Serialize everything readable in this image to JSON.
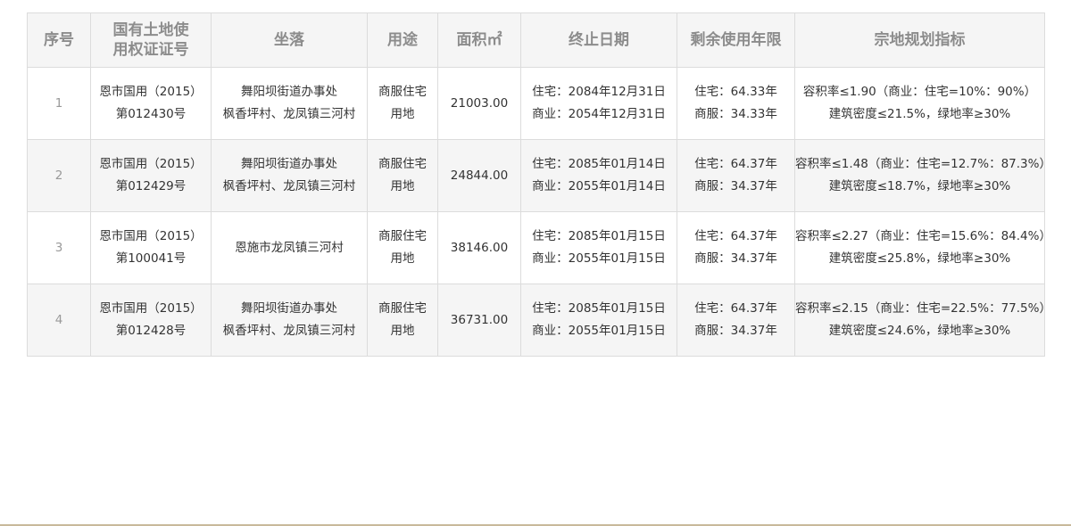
{
  "table": {
    "headers": [
      "序号",
      "国有土地使用权证证号",
      "坐落",
      "用途",
      "面积㎡",
      "终止日期",
      "剩余使用年限",
      "宗地规划指标"
    ],
    "header_lines": {
      "cert_line1": "国有土地使",
      "cert_line2": "用权证证号"
    },
    "rows": [
      {
        "idx": "1",
        "cert_l1": "恩市国用（2015）",
        "cert_l2": "第012430号",
        "loc_l1": "舞阳坝街道办事处",
        "loc_l2": "枫香坪村、龙凤镇三河村",
        "use_l1": "商服住宅",
        "use_l2": "用地",
        "area": "21003.00",
        "end_l1": "住宅：2084年12月31日",
        "end_l2": "商业：2054年12月31日",
        "rem_l1": "住宅：64.33年",
        "rem_l2": "商服：34.33年",
        "spec_l1": "容积率≤1.90（商业：住宅=10%：90%）",
        "spec_l2": "建筑密度≤21.5%，绿地率≥30%"
      },
      {
        "idx": "2",
        "cert_l1": "恩市国用（2015）",
        "cert_l2": "第012429号",
        "loc_l1": "舞阳坝街道办事处",
        "loc_l2": "枫香坪村、龙凤镇三河村",
        "use_l1": "商服住宅",
        "use_l2": "用地",
        "area": "24844.00",
        "end_l1": "住宅：2085年01月14日",
        "end_l2": "商业：2055年01月14日",
        "rem_l1": "住宅：64.37年",
        "rem_l2": "商服：34.37年",
        "spec_l1": "容积率≤1.48（商业：住宅=12.7%：87.3%）",
        "spec_l2": "建筑密度≤18.7%，绿地率≥30%"
      },
      {
        "idx": "3",
        "cert_l1": "恩市国用（2015）",
        "cert_l2": "第100041号",
        "loc_l1": "恩施市龙凤镇三河村",
        "loc_l2": "",
        "use_l1": "商服住宅",
        "use_l2": "用地",
        "area": "38146.00",
        "end_l1": "住宅：2085年01月15日",
        "end_l2": "商业：2055年01月15日",
        "rem_l1": "住宅：64.37年",
        "rem_l2": "商服：34.37年",
        "spec_l1": "容积率≤2.27（商业：住宅=15.6%：84.4%）",
        "spec_l2": "建筑密度≤25.8%，绿地率≥30%"
      },
      {
        "idx": "4",
        "cert_l1": "恩市国用（2015）",
        "cert_l2": "第012428号",
        "loc_l1": "舞阳坝街道办事处",
        "loc_l2": "枫香坪村、龙凤镇三河村",
        "use_l1": "商服住宅",
        "use_l2": "用地",
        "area": "36731.00",
        "end_l1": "住宅：2085年01月15日",
        "end_l2": "商业：2055年01月15日",
        "rem_l1": "住宅：64.37年",
        "rem_l2": "商服：34.37年",
        "spec_l1": "容积率≤2.15（商业：住宅=22.5%：77.5%）",
        "spec_l2": "建筑密度≤24.6%，绿地率≥30%"
      }
    ]
  },
  "colors": {
    "header_bg": "#f5f5f5",
    "header_text": "#8c8c8c",
    "border": "#dcdcdc",
    "alt_row_bg": "#f5f5f5",
    "bottom_rule": "#c8b99a"
  }
}
